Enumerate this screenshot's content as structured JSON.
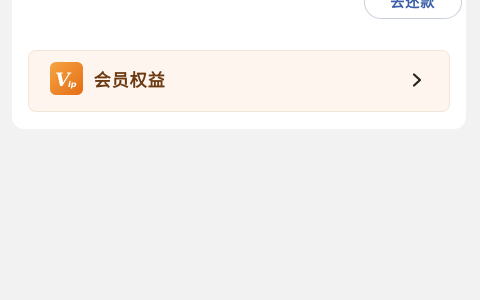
{
  "actions": {
    "repay_label": "去还款"
  },
  "vip_banner": {
    "label": "会员权益",
    "icon": "vip-badge-icon",
    "chevron": "chevron-right-icon"
  },
  "colors": {
    "page_background": "#f2f2f2",
    "card_background": "#ffffff",
    "repay_text": "#3a5da8",
    "banner_background": "#fdf5ee",
    "vip_text": "#6b3a12",
    "vip_badge_start": "#f6a443",
    "vip_badge_end": "#e46d14"
  }
}
